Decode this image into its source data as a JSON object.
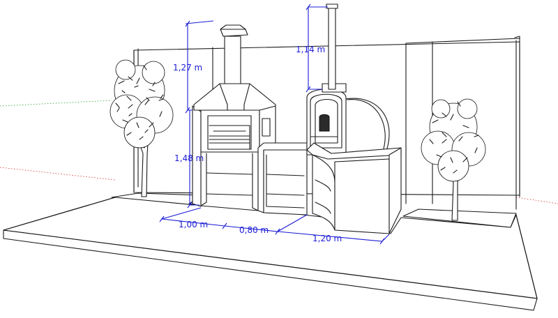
{
  "scene": {
    "dimensions": {
      "chimney_height": "1,27 m",
      "barbecue_height": "1,48 m",
      "oven_chimney_height": "1,14 m",
      "barbecue_width": "1,00 m",
      "middle_width": "0,80 m",
      "oven_width": "1,20 m"
    },
    "colors": {
      "dimension": "#1b1bd6",
      "axis_green": "#2aa02a",
      "axis_red": "#d03030",
      "line": "#1a1a1a"
    }
  }
}
